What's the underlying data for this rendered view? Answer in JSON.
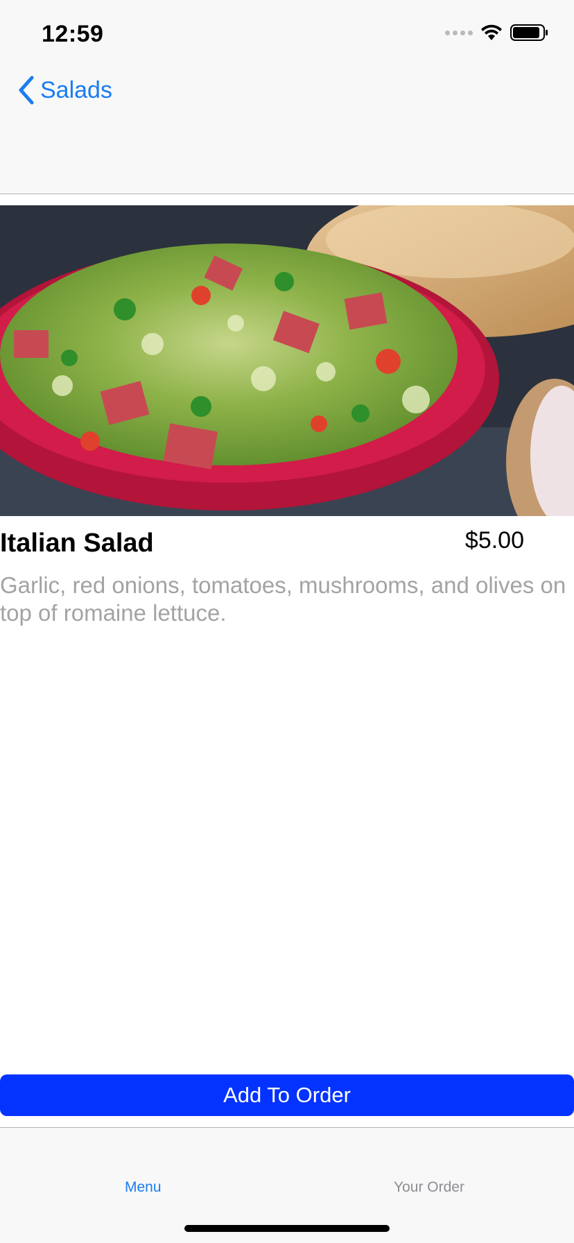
{
  "status_bar": {
    "time": "12:59"
  },
  "nav": {
    "back_label": "Salads"
  },
  "item": {
    "name": "Italian Salad",
    "price": "$5.00",
    "description": "Garlic, red onions, tomatoes, mushrooms, and olives on top of romaine lettuce.",
    "image_icon": "salad-photo"
  },
  "actions": {
    "add_label": "Add To Order"
  },
  "tabs": [
    {
      "label": "Menu",
      "selected": true
    },
    {
      "label": "Your Order",
      "selected": false
    }
  ],
  "colors": {
    "accent": "#1a7cf2",
    "button": "#0433ff",
    "description": "#a3a3a3",
    "tab_inactive": "#8e8e93"
  }
}
